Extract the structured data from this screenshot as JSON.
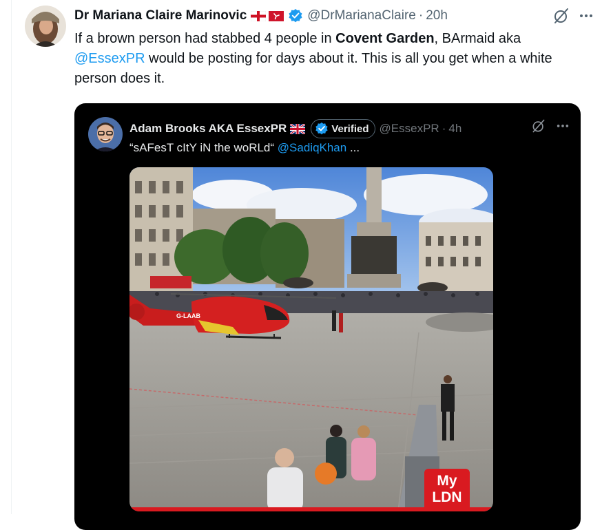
{
  "tweet": {
    "author_name": "Dr Mariana Claire Marinovic",
    "handle": "@DrMarianaClaire",
    "separator": "·",
    "time": "20h",
    "text_part1": "If a brown person had stabbed 4 people in ",
    "text_bold": "Covent Garden",
    "text_part2": ", BArmaid aka ",
    "mention": "@EssexPR",
    "text_part3": " would be posting for days about it. This is all you get when a white person does it."
  },
  "quoted": {
    "author_name": "Adam Brooks AKA EssexPR",
    "badge_label": "Verified",
    "handle": "@EssexPR",
    "separator": "·",
    "time": "4h",
    "text": "“sAFesT cItY iN the woRLd“ ",
    "mention": "@SadiqKhan",
    "ellipsis": " ...",
    "photo_logo_line1": "My",
    "photo_logo_line2": "LDN",
    "helicopter_reg": "G-LAAB"
  },
  "colors": {
    "accent": "#1d9bf0",
    "brand_red": "#d91a20",
    "muted": "#536471"
  },
  "icons": [
    "grok-icon",
    "more-icon",
    "verified-icon",
    "england-flag-icon",
    "isle-of-man-flag-icon",
    "uk-flag-icon"
  ]
}
